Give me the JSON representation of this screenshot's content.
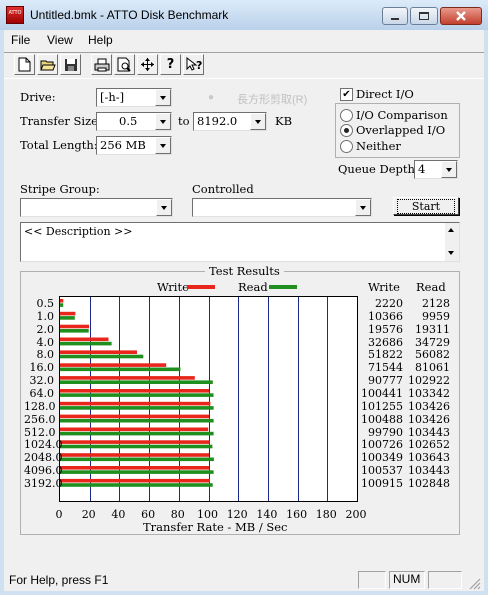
{
  "window": {
    "title": "Untitled.bmk - ATTO Disk Benchmark",
    "icon_label": "ATTO"
  },
  "menu": [
    "File",
    "View",
    "Help"
  ],
  "toolbar": [
    "new-icon",
    "open-icon",
    "save-icon",
    "print-icon",
    "print-preview-icon",
    "move-icon",
    "help-icon",
    "context-help-icon"
  ],
  "form": {
    "drive_label": "Drive:",
    "drive_value": "[-h-]",
    "watermark_text": "長方形剪取(R)",
    "transfer_size_label": "Transfer Size:",
    "transfer_from": "0.5",
    "to_label": "to",
    "transfer_to": "8192.0",
    "kb_label": "KB",
    "total_length_label": "Total Length:",
    "total_length_value": "256 MB",
    "direct_io_label": "Direct I/O",
    "direct_io_checked": true,
    "io_comparison_label": "I/O Comparison",
    "overlapped_io_label": "Overlapped I/O",
    "neither_label": "Neither",
    "selected_mode": "Overlapped I/O",
    "queue_depth_label": "Queue Depth:",
    "queue_depth_value": "4",
    "stripe_group_label": "Stripe Group:",
    "stripe_group_value": "",
    "controlled_label": "Controlled",
    "controlled_value": "",
    "start_label": "Start",
    "description_text": "<< Description >>"
  },
  "results": {
    "group_title": "Test Results",
    "legend_write": "Write",
    "legend_read": "Read",
    "col_write": "Write",
    "col_read": "Read",
    "write_color": "#e8261c",
    "read_color": "#1f8f1f"
  },
  "chart_data": {
    "type": "bar",
    "orientation": "horizontal",
    "xlabel": "Transfer Rate - MB / Sec",
    "xlim": [
      0,
      200
    ],
    "xticks": [
      0,
      20,
      40,
      60,
      80,
      100,
      120,
      140,
      160,
      180,
      200
    ],
    "categories": [
      "0.5",
      "1.0",
      "2.0",
      "4.0",
      "8.0",
      "16.0",
      "32.0",
      "64.0",
      "128.0",
      "256.0",
      "512.0",
      "1024.0",
      "2048.0",
      "4096.0",
      "3192.0"
    ],
    "series": [
      {
        "name": "Write",
        "color": "#e8261c",
        "values": [
          2220,
          10366,
          19576,
          32686,
          51822,
          71544,
          90777,
          100441,
          101255,
          100488,
          99790,
          100726,
          100349,
          100537,
          100915
        ]
      },
      {
        "name": "Read",
        "color": "#1f8f1f",
        "values": [
          2128,
          9959,
          19311,
          34729,
          56082,
          81061,
          102922,
          103342,
          103426,
          103426,
          103443,
          102652,
          103643,
          103443,
          102848
        ]
      }
    ]
  },
  "status": {
    "text": "For Help, press F1",
    "num_label": "NUM"
  }
}
